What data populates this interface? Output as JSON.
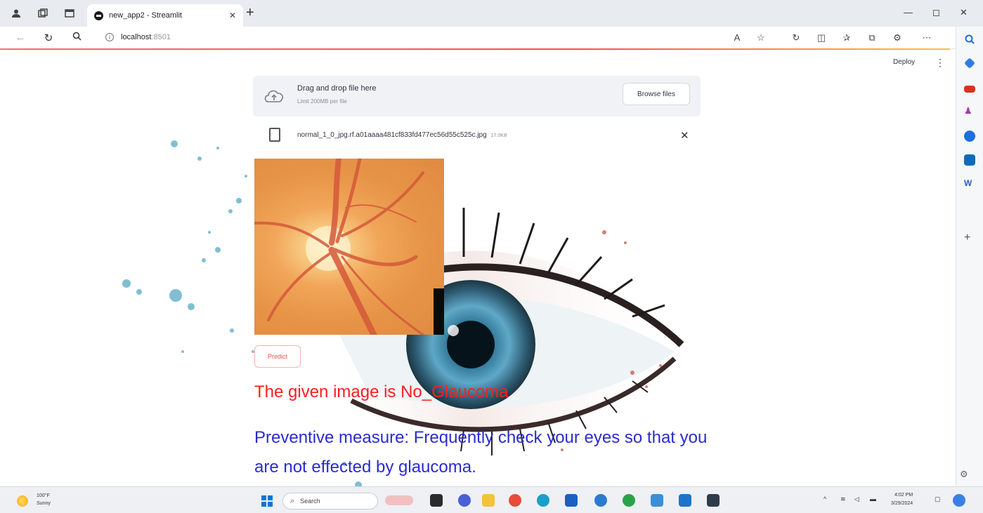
{
  "browser": {
    "tab_title": "new_app2 - Streamlit",
    "address": "localhost",
    "address_port": ":8501"
  },
  "app": {
    "deploy_label": "Deploy",
    "menu_label": "⋮"
  },
  "uploader": {
    "drag_text": "Drag and drop file here",
    "limit_text": "Limit 200MB per file",
    "browse_label": "Browse files",
    "file_name": "normal_1_0_jpg.rf.a01aaaa481cf833fd477ec56d55c525c.jpg",
    "file_size": "17.0KB",
    "remove_label": "✕"
  },
  "predict_label": "Predict",
  "result_text": "The given image is No_Glaucoma",
  "preventive_text": "Preventive measure: Frequently check your eyes so that you are not effected by glaucoma.",
  "taskbar": {
    "weather_temp": "100°F",
    "weather_desc": "Sunny",
    "search_placeholder": "Search",
    "time": "4:02 PM",
    "date": "3/29/2024"
  },
  "colors": {
    "accent": "#ff4b4b",
    "result_red": "#ff1e1e",
    "prevent_blue": "#2b2bd0"
  }
}
